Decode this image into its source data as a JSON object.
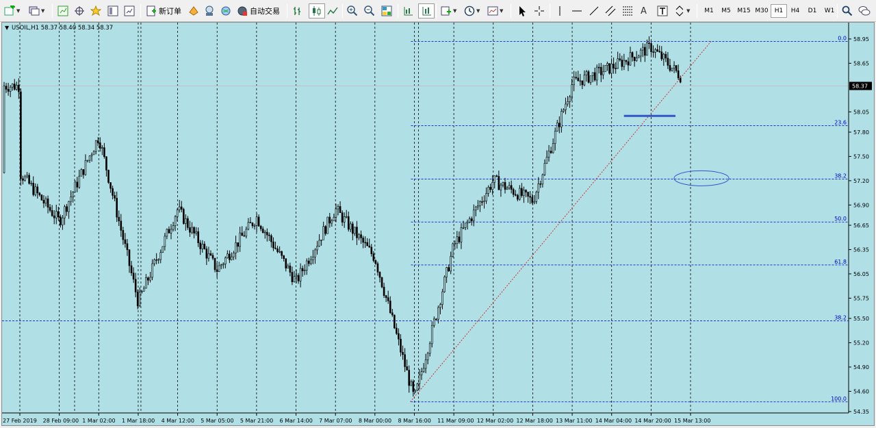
{
  "toolbar": {
    "new_order_label": "新订单",
    "auto_trading_label": "自动交易",
    "text_tool_label": "A",
    "timeframes": [
      "M1",
      "M5",
      "M15",
      "M30",
      "H1",
      "H4",
      "D1",
      "W1"
    ],
    "active_timeframe": "H1"
  },
  "chart": {
    "header": "USOIL,H1  58.37 58.40 58.34 58.37",
    "current_price_label": "58.37",
    "background_color": "#b0dfe5",
    "candle_color": "#000000"
  },
  "chart_data": {
    "type": "candlestick",
    "symbol": "USOIL",
    "timeframe": "H1",
    "ohlc_last": {
      "open": 58.37,
      "high": 58.4,
      "low": 58.34,
      "close": 58.37
    },
    "y_ticks": [
      "58.95",
      "58.65",
      "58.37",
      "58.05",
      "57.80",
      "57.50",
      "57.20",
      "56.90",
      "56.65",
      "56.35",
      "56.05",
      "55.75",
      "55.50",
      "55.20",
      "54.90",
      "54.60",
      "54.35"
    ],
    "x_ticks": [
      "27 Feb 2019",
      "28 Feb 09:00",
      "1 Mar 02:00",
      "1 Mar 18:00",
      "4 Mar 12:00",
      "5 Mar 05:00",
      "5 Mar 21:00",
      "6 Mar 14:00",
      "7 Mar 07:00",
      "8 Mar 00:00",
      "8 Mar 16:00",
      "11 Mar 09:00",
      "12 Mar 02:00",
      "12 Mar 18:00",
      "13 Mar 11:00",
      "14 Mar 04:00",
      "14 Mar 20:00",
      "15 Mar 13:00"
    ],
    "ylim": [
      54.35,
      59.0
    ],
    "current_price": 58.37,
    "fibonacci": {
      "label_color": "#0000cc",
      "levels": [
        {
          "label": "0.0",
          "price": 58.92
        },
        {
          "label": "23.6",
          "price": 57.88
        },
        {
          "label": "38.2",
          "price": 57.22
        },
        {
          "label": "50.0",
          "price": 56.69
        },
        {
          "label": "61.8",
          "price": 56.16
        },
        {
          "label": "100.0",
          "price": 54.47
        }
      ],
      "extra_level": {
        "label": "38.2",
        "price": 55.47
      }
    },
    "support_line": {
      "price": 58.0,
      "color": "#3355cc"
    },
    "key_points": [
      {
        "x": "27 Feb 2019",
        "price": 57.3
      },
      {
        "x": "28 Feb 09:00",
        "price": 56.7
      },
      {
        "x": "1 Mar 02:00",
        "price": 57.75
      },
      {
        "x": "1 Mar 18:00",
        "price": 55.7
      },
      {
        "x": "4 Mar 12:00",
        "price": 56.85
      },
      {
        "x": "5 Mar 05:00",
        "price": 56.1
      },
      {
        "x": "5 Mar 21:00",
        "price": 56.75
      },
      {
        "x": "6 Mar 14:00",
        "price": 55.95
      },
      {
        "x": "7 Mar 07:00",
        "price": 56.85
      },
      {
        "x": "8 Mar 00:00",
        "price": 56.25
      },
      {
        "x": "8 Mar 16:00",
        "price": 54.5
      },
      {
        "x": "11 Mar 09:00",
        "price": 56.4
      },
      {
        "x": "12 Mar 02:00",
        "price": 57.2
      },
      {
        "x": "12 Mar 18:00",
        "price": 56.95
      },
      {
        "x": "13 Mar 11:00",
        "price": 58.4
      },
      {
        "x": "14 Mar 04:00",
        "price": 58.6
      },
      {
        "x": "14 Mar 20:00",
        "price": 58.85
      },
      {
        "x": "15 Mar 13:00",
        "price": 58.37
      }
    ]
  }
}
